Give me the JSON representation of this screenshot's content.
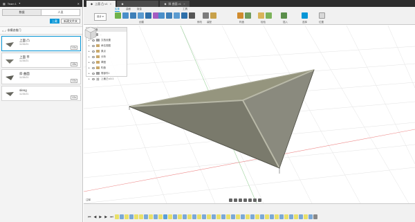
{
  "left_panel": {
    "team_name": "Team 1",
    "tabs": [
      "数据",
      "人员"
    ],
    "upload_label": "上载",
    "new_folder_label": "新建文件夹",
    "breadcrumb": "非模态推门",
    "files": [
      {
        "name": "上面 凸",
        "date": "11/26/21",
        "version": "V1",
        "selected": true
      },
      {
        "name": "上面 平",
        "date": "11/26/21",
        "version": "V5",
        "selected": false
      },
      {
        "name": "斜 曲面",
        "date": "11/26/21",
        "version": "V1",
        "selected": false
      },
      {
        "name": "sleng",
        "date": "11/26/21",
        "version": "V1",
        "selected": false
      }
    ]
  },
  "doc_tabs": [
    {
      "label": "上面 凸 v1",
      "active": true
    },
    {
      "label": "",
      "active": false
    },
    {
      "label": "斜 曲面 v1",
      "active": false
    }
  ],
  "toolbar": {
    "workspace": "设计",
    "tab_labels": [
      "实体",
      "曲面",
      "钣金",
      "工具"
    ],
    "active_tab": "实体",
    "groups": [
      "创建",
      "修改",
      "装配",
      "构造",
      "检验",
      "插入",
      "选择",
      "位置"
    ]
  },
  "browser": {
    "title": "浏览器",
    "items": [
      "文档设置",
      "命名视图",
      "原点",
      "分析",
      "草图",
      "构造",
      "零部件1",
      "上面凸 v1:1"
    ]
  },
  "canvas": {
    "comments_label": "注释"
  },
  "colors": {
    "accent": "#0696d7",
    "dark_bar": "#2d2d2d",
    "model_face": "#8a8a7e",
    "model_edge": "#6e6e64"
  }
}
